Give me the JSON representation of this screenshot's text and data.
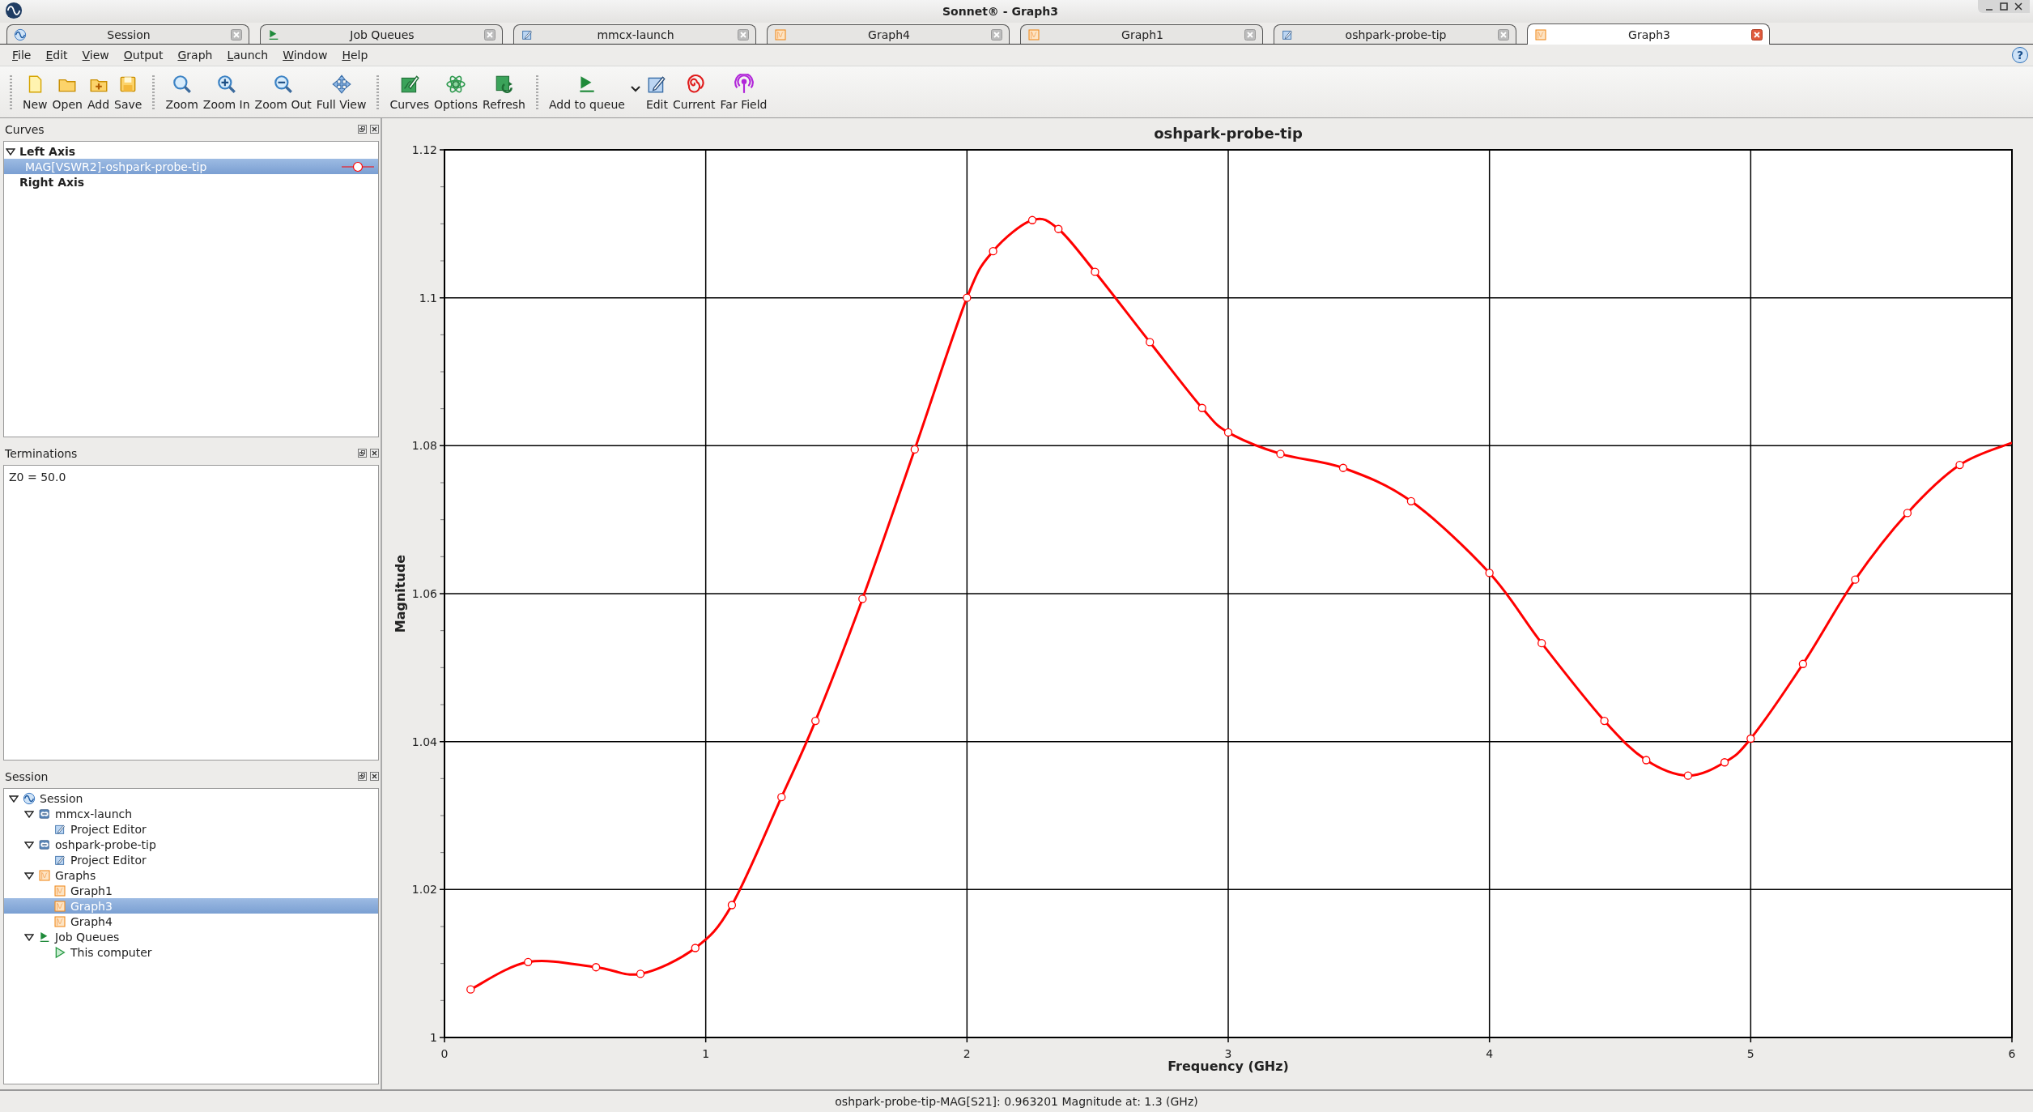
{
  "window": {
    "title": "Sonnet® - Graph3"
  },
  "tabs": [
    {
      "label": "Session",
      "kind": "session",
      "selected": false
    },
    {
      "label": "Job Queues",
      "kind": "queue",
      "selected": false
    },
    {
      "label": "mmcx-launch",
      "kind": "editor",
      "selected": false
    },
    {
      "label": "Graph4",
      "kind": "graph",
      "selected": false
    },
    {
      "label": "Graph1",
      "kind": "graph",
      "selected": false
    },
    {
      "label": "oshpark-probe-tip",
      "kind": "editor",
      "selected": false
    },
    {
      "label": "Graph3",
      "kind": "graph",
      "selected": true
    }
  ],
  "menu": [
    "File",
    "Edit",
    "View",
    "Output",
    "Graph",
    "Launch",
    "Window",
    "Help"
  ],
  "help_button": "?",
  "toolbar": [
    [
      {
        "label": "New",
        "kind": "new"
      },
      {
        "label": "Open",
        "kind": "open"
      },
      {
        "label": "Add",
        "kind": "add"
      },
      {
        "label": "Save",
        "kind": "save"
      }
    ],
    [
      {
        "label": "Zoom",
        "kind": "zoom"
      },
      {
        "label": "Zoom In",
        "kind": "zoom-in"
      },
      {
        "label": "Zoom Out",
        "kind": "zoom-out"
      },
      {
        "label": "Full View",
        "kind": "full-view"
      }
    ],
    [
      {
        "label": "Curves",
        "kind": "curves"
      },
      {
        "label": "Options",
        "kind": "options"
      },
      {
        "label": "Refresh",
        "kind": "refresh"
      }
    ],
    [
      {
        "label": "Add to queue",
        "kind": "queue"
      },
      {
        "label": "Edit",
        "kind": "edit"
      },
      {
        "label": "Current",
        "kind": "current"
      },
      {
        "label": "Far Field",
        "kind": "far-field"
      }
    ]
  ],
  "curves_panel": {
    "title": "Curves",
    "tree": [
      {
        "label": "Left Axis",
        "children": [
          {
            "label": "MAG[VSWR2]-oshpark-probe-tip",
            "selected": true
          }
        ]
      },
      {
        "label": "Right Axis"
      }
    ]
  },
  "terminations_panel": {
    "title": "Terminations",
    "text": "Z0 = 50.0"
  },
  "session_panel": {
    "title": "Session",
    "tree": [
      {
        "label": "Session",
        "kind": "session",
        "selected": false,
        "children": [
          {
            "label": "mmcx-launch",
            "kind": "project",
            "selected": false,
            "children": [
              {
                "label": "Project Editor",
                "kind": "editor",
                "selected": false
              }
            ]
          },
          {
            "label": "oshpark-probe-tip",
            "kind": "project",
            "selected": false,
            "children": [
              {
                "label": "Project Editor",
                "kind": "editor",
                "selected": false
              }
            ]
          },
          {
            "label": "Graphs",
            "kind": "graph",
            "selected": false,
            "children": [
              {
                "label": "Graph1",
                "kind": "graph",
                "selected": false
              },
              {
                "label": "Graph3",
                "kind": "graph",
                "selected": true
              },
              {
                "label": "Graph4",
                "kind": "graph",
                "selected": false
              }
            ]
          },
          {
            "label": "Job Queues",
            "kind": "queue",
            "selected": false,
            "children": [
              {
                "label": "This computer",
                "kind": "computer",
                "selected": false
              }
            ]
          }
        ]
      }
    ]
  },
  "chart": {
    "chart_data": {
      "type": "line",
      "title": "oshpark-probe-tip",
      "xlabel": "Frequency (GHz)",
      "ylabel": "Magnitude",
      "x": [
        0.1,
        0.32,
        0.58,
        0.75,
        0.96,
        1.1,
        1.29,
        1.42,
        1.6,
        1.8,
        2.0,
        2.1,
        2.25,
        2.35,
        2.49,
        2.7,
        2.9,
        3.0,
        3.2,
        3.44,
        3.7,
        4.0,
        4.2,
        4.44,
        4.6,
        4.76,
        4.9,
        5.0,
        5.2,
        5.4,
        5.6,
        5.8,
        6.0
      ],
      "grid": true,
      "series": [
        {
          "color": "#ff0000",
          "marker": "circle",
          "values": [
            1.0065,
            1.0102,
            1.0095,
            1.0086,
            1.0121,
            1.0179,
            1.0325,
            1.0428,
            1.0593,
            1.0795,
            1.1,
            1.1063,
            1.1105,
            1.1093,
            1.1035,
            1.094,
            1.0851,
            1.0818,
            1.0789,
            1.077,
            1.0725,
            1.0628,
            1.0533,
            1.0428,
            1.0375,
            1.0354,
            1.0372,
            1.0404,
            1.0505,
            1.0619,
            1.0709,
            1.0774,
            1.0804
          ]
        }
      ],
      "xlim": [
        0,
        6
      ],
      "ylim": [
        1,
        1.12
      ],
      "xticks": [
        0,
        1,
        2,
        3,
        4,
        5,
        6
      ],
      "yticks": [
        1,
        1.02,
        1.04,
        1.06,
        1.08,
        1.1,
        1.12
      ]
    }
  },
  "status_bar": "oshpark-probe-tip-MAG[S21]: 0.963201 Magnitude at: 1.3 (GHz)"
}
